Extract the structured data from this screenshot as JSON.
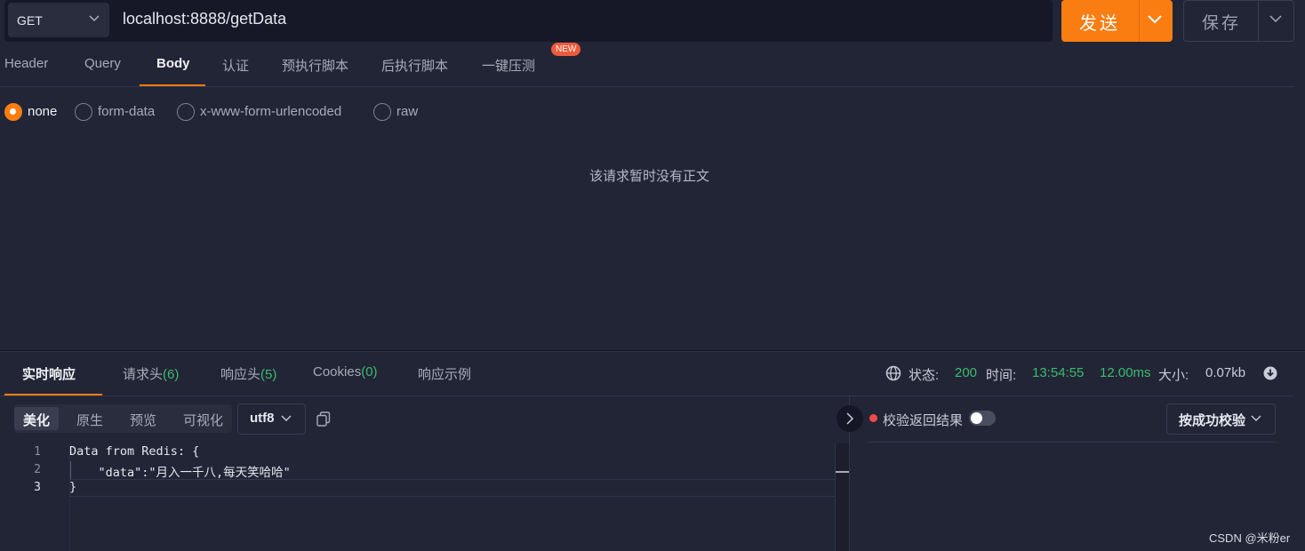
{
  "request": {
    "method": "GET",
    "url": "localhost:8888/getData",
    "send_label": "发送",
    "save_label": "保存"
  },
  "request_tabs": [
    "Header",
    "Query",
    "Body",
    "认证",
    "预执行脚本",
    "后执行脚本",
    "一键压测"
  ],
  "new_badge": "NEW",
  "body_types": [
    "none",
    "form-data",
    "x-www-form-urlencoded",
    "raw"
  ],
  "empty_body_text": "该请求暂时没有正文",
  "response_tabs": {
    "realtime": "实时响应",
    "req_headers": "请求头",
    "req_headers_count": "(6)",
    "resp_headers": "响应头",
    "resp_headers_count": "(5)",
    "cookies": "Cookies",
    "cookies_count": "(0)",
    "example": "响应示例"
  },
  "status": {
    "status_label": "状态:",
    "status_code": "200",
    "time_label": "时间:",
    "time": "13:54:55",
    "duration": "12.00ms",
    "size_label": "大小:",
    "size": "0.07kb"
  },
  "view_modes": [
    "美化",
    "原生",
    "预览",
    "可视化"
  ],
  "encoding": "utf8",
  "code_lines": [
    {
      "num": "1",
      "text": "Data from Redis: {"
    },
    {
      "num": "2",
      "text": "    \"data\":\"月入一千八,每天笑哈哈\""
    },
    {
      "num": "3",
      "text": "}"
    }
  ],
  "verify": {
    "label": "校验返回结果",
    "dropdown": "按成功校验"
  },
  "watermark": "CSDN @米粉er",
  "colors": {
    "accent": "#fa7d12",
    "success": "#3dbb6e",
    "background": "#222536"
  }
}
